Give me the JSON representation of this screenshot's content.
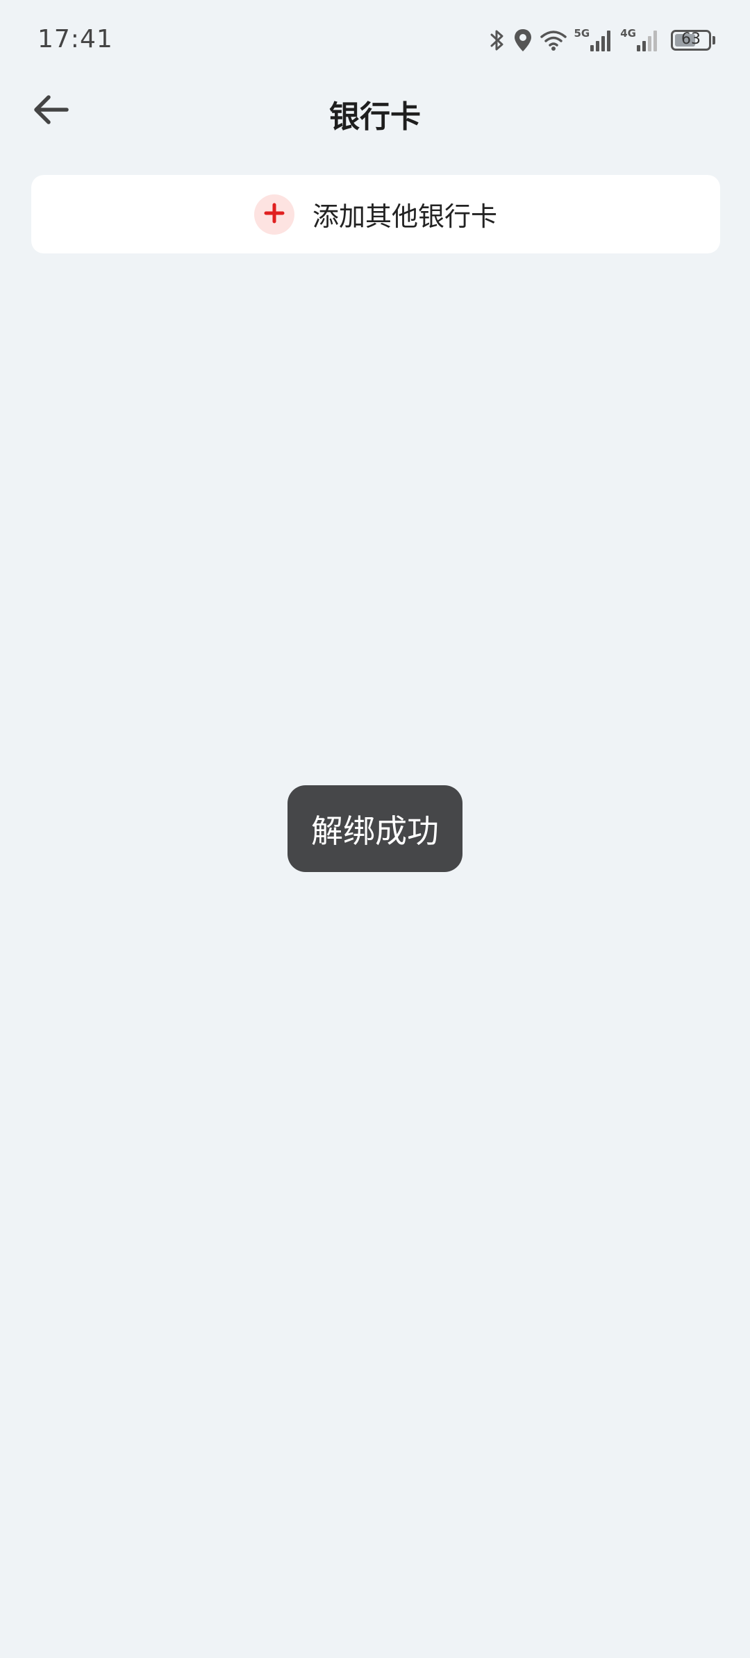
{
  "status_bar": {
    "time": "17:41",
    "net_label_1": "5G",
    "net_label_2": "4G",
    "battery_level": "63",
    "battery_fraction": 0.63
  },
  "header": {
    "title": "银行卡"
  },
  "add_card": {
    "label": "添加其他银行卡",
    "accent_color": "#e02020"
  },
  "toast": {
    "text": "解绑成功"
  },
  "colors": {
    "background": "#eff3f6",
    "card": "#ffffff",
    "toast_bg": "#464749",
    "add_icon_bg": "#fde3e1"
  }
}
